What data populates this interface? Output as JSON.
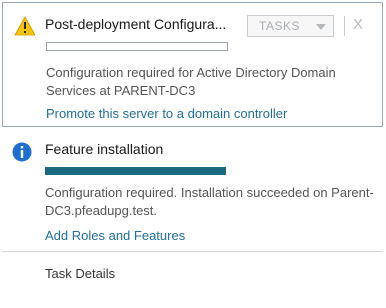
{
  "notifications": [
    {
      "title": "Post-deployment Configura...",
      "icon": "warning-icon",
      "progress": 0,
      "description": "Configuration required for Active Directory Domain Services at PARENT-DC3",
      "link": "Promote this server to a domain controller"
    },
    {
      "title": "Feature installation",
      "icon": "info-icon",
      "progress": 1.0,
      "description": "Configuration required. Installation succeeded on Parent-DC3.pfeadupg.test.",
      "link": "Add Roles and Features"
    }
  ],
  "toolbar": {
    "tasks_label": "TASKS",
    "close_glyph": "X"
  },
  "footer": {
    "task_details_label": "Task Details"
  },
  "colors": {
    "accent": "#1b6a80",
    "link": "#1e6f9f",
    "warning": "#f5c400",
    "info": "#1f6fcf"
  }
}
